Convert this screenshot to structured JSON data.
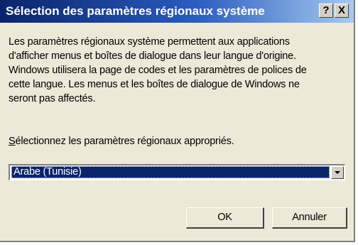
{
  "window": {
    "title": "Sélection des paramètres régionaux système",
    "help_label": "?",
    "close_label": "X"
  },
  "description": {
    "lines": [
      "Les paramètres régionaux système permettent aux applications",
      "d'afficher menus et boîtes de dialogue dans leur langue d'origine.",
      "Windows utilisera la page de codes et les paramètres de polices de",
      "cette langue. Les menus et les boîtes de dialogue de Windows ne",
      "seront pas affectés."
    ]
  },
  "prompt": {
    "mnemonic": "S",
    "rest": "électionnez les paramètres régionaux appropriés."
  },
  "locale_select": {
    "selected": "Arabe (Tunisie)"
  },
  "buttons": {
    "ok": "OK",
    "cancel": "Annuler"
  }
}
